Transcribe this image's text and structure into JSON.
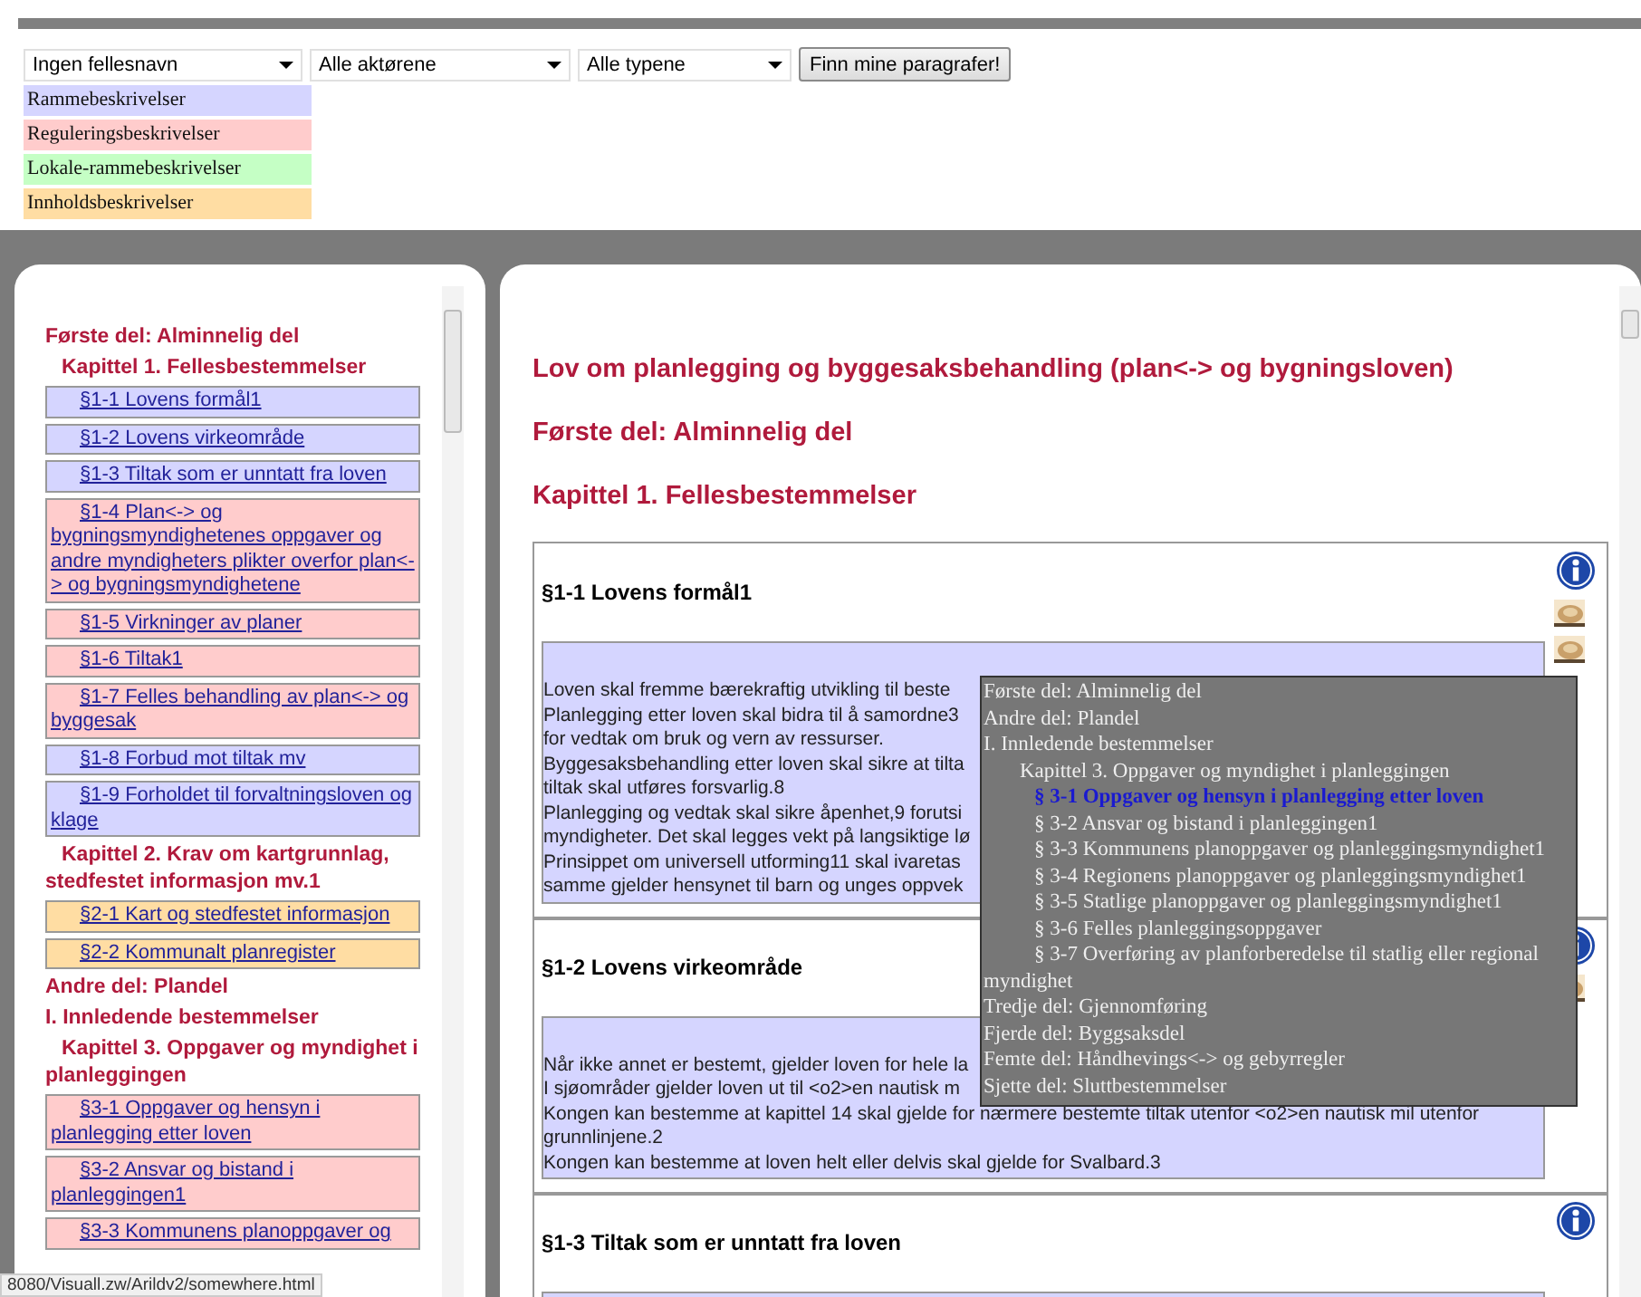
{
  "filters": {
    "selects": [
      {
        "value": "Ingen fellesnavn"
      },
      {
        "value": "Alle aktørene"
      },
      {
        "value": "Alle typene"
      }
    ],
    "button": "Finn mine paragrafer!"
  },
  "legend": [
    {
      "label": "Rammebeskrivelser",
      "color": "#d5d5ff"
    },
    {
      "label": "Reguleringsbeskrivelser",
      "color": "#ffcccc"
    },
    {
      "label": "Lokale-rammebeskrivelser",
      "color": "#c5ffc5"
    },
    {
      "label": "Innholdsbeskrivelser",
      "color": "#ffdda3"
    }
  ],
  "sidebar": {
    "items": [
      {
        "kind": "part",
        "text": "Første del: Alminnelig del",
        "children": [
          {
            "kind": "chapter",
            "text": "Kapittel 1. Fellesbestemmelser",
            "children": [
              {
                "kind": "link",
                "text": "§1-1 Lovens formål1",
                "color": "#d5d5ff"
              },
              {
                "kind": "link",
                "text": "§1-2 Lovens virkeområde",
                "color": "#d5d5ff"
              },
              {
                "kind": "link",
                "text": "§1-3 Tiltak som er unntatt fra loven",
                "color": "#d5d5ff"
              },
              {
                "kind": "link",
                "text": "§1-4 Plan<-> og bygningsmyndighetenes oppgaver og andre myndigheters plikter overfor plan<-> og bygningsmyndighetene",
                "color": "#ffcccc"
              },
              {
                "kind": "link",
                "text": "§1-5 Virkninger av planer",
                "color": "#ffcccc"
              },
              {
                "kind": "link",
                "text": "§1-6 Tiltak1",
                "color": "#ffcccc"
              },
              {
                "kind": "link",
                "text": "§1-7 Felles behandling av plan<-> og byggesak",
                "color": "#ffcccc"
              },
              {
                "kind": "link",
                "text": "§1-8 Forbud mot tiltak mv",
                "color": "#d5d5ff"
              },
              {
                "kind": "link",
                "text": "§1-9 Forholdet til forvaltningsloven og klage",
                "color": "#d5d5ff"
              }
            ]
          },
          {
            "kind": "chapter",
            "text": "Kapittel 2. Krav om kartgrunnlag, stedfestet informasjon mv.1",
            "children": [
              {
                "kind": "link",
                "text": "§2-1 Kart og stedfestet informasjon",
                "color": "#ffdda3"
              },
              {
                "kind": "link",
                "text": "§2-2 Kommunalt planregister",
                "color": "#ffdda3"
              }
            ]
          }
        ]
      },
      {
        "kind": "part",
        "text": "Andre del: Plandel",
        "children": [
          {
            "kind": "part",
            "text": "I. Innledende bestemmelser",
            "children": [
              {
                "kind": "chapter",
                "text": "Kapittel 3. Oppgaver og myndighet i planleggingen",
                "children": [
                  {
                    "kind": "link",
                    "text": "§3-1 Oppgaver og hensyn i planlegging etter loven",
                    "color": "#ffcccc"
                  },
                  {
                    "kind": "link",
                    "text": "§3-2 Ansvar og bistand i planleggingen1",
                    "color": "#ffcccc"
                  },
                  {
                    "kind": "link",
                    "text": "§3-3 Kommunens planoppgaver og",
                    "color": "#ffcccc"
                  }
                ]
              }
            ]
          }
        ]
      }
    ]
  },
  "content": {
    "headings": [
      "Lov om planlegging og byggesaksbehandling (plan<-> og bygningsloven)",
      "Første del: Alminnelig del",
      "Kapittel 1. Fellesbestemmelser"
    ],
    "sections": [
      {
        "heading": "§1-1 Lovens formål1",
        "icons": [
          {
            "kind": "info"
          },
          {
            "kind": "thumbnail"
          },
          {
            "kind": "thumbnail"
          }
        ],
        "color": "#d5d5ff",
        "lines": [
          "Loven skal fremme bærekraftig utvikling til beste",
          "Planlegging etter loven skal bidra til å samordne3",
          "for vedtak om bruk og vern av ressurser.",
          "Byggesaksbehandling etter loven skal sikre at tilta",
          "tiltak skal utføres forsvarlig.8",
          "Planlegging og vedtak skal sikre åpenhet,9 forutsi",
          "myndigheter. Det skal legges vekt på langsiktige lø",
          "Prinsippet om universell utforming11 skal ivaretas",
          "samme gjelder hensynet til barn og unges oppvek"
        ]
      },
      {
        "heading": "§1-2 Lovens virkeområde",
        "icons": [
          {
            "kind": "info"
          },
          {
            "kind": "thumbnail"
          }
        ],
        "color": "#d5d5ff",
        "lines": [
          "Når ikke annet er bestemt, gjelder loven for hele la",
          "I sjøområder gjelder loven ut til <o2>en nautisk m",
          "Kongen kan bestemme at kapittel 14 skal gjelde for nærmere bestemte tiltak utenfor <o2>en nautisk mil utenfor grunnlinjene.2",
          "Kongen kan bestemme at loven helt eller delvis skal gjelde for Svalbard.3"
        ]
      },
      {
        "heading": "§1-3 Tiltak som er unntatt fra loven",
        "icons": [
          {
            "kind": "info"
          }
        ],
        "color": "#d5d5ff"
      }
    ]
  },
  "tooltip": {
    "items": [
      {
        "kind": "part",
        "text": "Første del: Alminnelig del"
      },
      {
        "kind": "part",
        "text": "Andre del: Plandel",
        "children": [
          {
            "kind": "part",
            "text": "I. Innledende bestemmelser",
            "children": [
              {
                "kind": "chapter",
                "text": "Kapittel 3. Oppgaver og myndighet i planleggingen",
                "children": [
                  {
                    "kind": "section",
                    "text": "§ 3-1 Oppgaver og hensyn i planlegging etter loven",
                    "selected": true
                  },
                  {
                    "kind": "section",
                    "text": "§ 3-2 Ansvar og bistand i planleggingen1",
                    "selected": false
                  },
                  {
                    "kind": "section",
                    "text": "§ 3-3 Kommunens planoppgaver og planleggingsmyndighet1",
                    "selected": false
                  },
                  {
                    "kind": "section",
                    "text": "§ 3-4 Regionens planoppgaver og planleggingsmyndighet1",
                    "selected": false
                  },
                  {
                    "kind": "section",
                    "text": "§ 3-5 Statlige planoppgaver og planleggingsmyndighet1",
                    "selected": false
                  },
                  {
                    "kind": "section",
                    "text": "§ 3-6 Felles planleggingsoppgaver",
                    "selected": false
                  },
                  {
                    "kind": "section",
                    "text": "§ 3-7 Overføring av planforberedelse til statlig eller regional myndighet",
                    "selected": false
                  }
                ]
              }
            ]
          }
        ]
      },
      {
        "kind": "part",
        "text": "Tredje del: Gjennomføring"
      },
      {
        "kind": "part",
        "text": "Fjerde del: Byggsaksdel"
      },
      {
        "kind": "part",
        "text": "Femte del: Håndhevings<-> og gebyrregler"
      },
      {
        "kind": "part",
        "text": "Sjette del: Sluttbestemmelser"
      }
    ]
  },
  "status_bar": "8080/Visuall.zw/Arildv2/somewhere.html"
}
